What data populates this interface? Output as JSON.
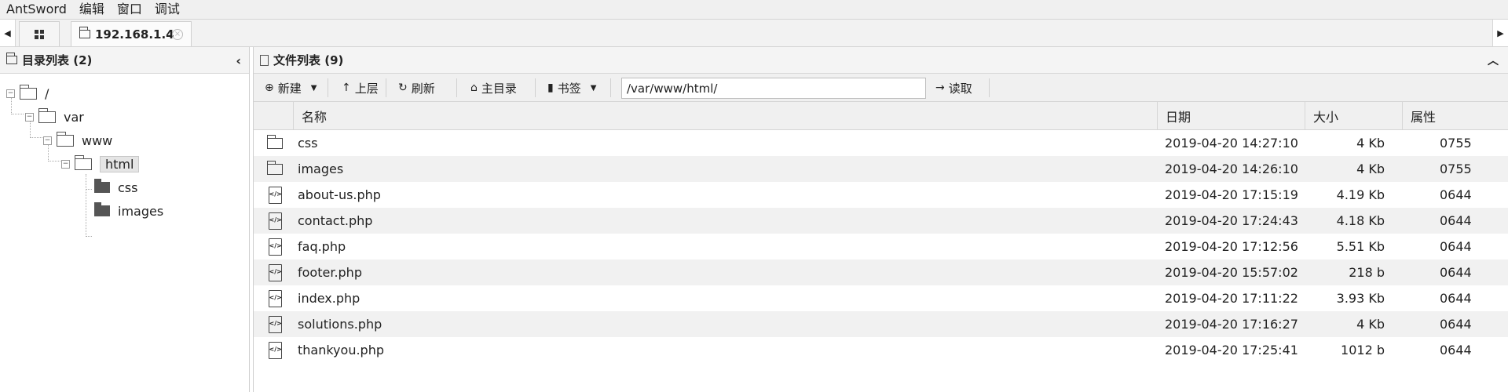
{
  "menu": [
    "AntSword",
    "编辑",
    "窗口",
    "调试"
  ],
  "tabs": {
    "host_label": "192.168.1.4",
    "left_arrow": "◀",
    "right_arrow": "▶",
    "close_symbol": "×"
  },
  "dir_panel": {
    "title": "目录列表 (2)",
    "collapse_symbol": "‹",
    "tree": [
      {
        "label": "/",
        "expander": "−"
      },
      {
        "label": "var",
        "expander": "−"
      },
      {
        "label": "www",
        "expander": "−"
      },
      {
        "label": "html",
        "expander": "−",
        "selected": true
      },
      {
        "label": "css"
      },
      {
        "label": "images"
      }
    ]
  },
  "file_panel": {
    "title": "文件列表 (9)",
    "collapse_symbol": "︿",
    "toolbar": {
      "new_label": "新建",
      "up_label": "上层",
      "refresh_label": "刷新",
      "home_label": "主目录",
      "bookmark_label": "书签",
      "path_value": "/var/www/html/",
      "read_label": "读取"
    },
    "columns": {
      "name": "名称",
      "date": "日期",
      "size": "大小",
      "attr": "属性"
    },
    "files": [
      {
        "type": "folder",
        "name": "css",
        "date": "2019-04-20 14:27:10",
        "size": "4 Kb",
        "attr": "0755"
      },
      {
        "type": "folder",
        "name": "images",
        "date": "2019-04-20 14:26:10",
        "size": "4 Kb",
        "attr": "0755"
      },
      {
        "type": "file",
        "name": "about-us.php",
        "date": "2019-04-20 17:15:19",
        "size": "4.19 Kb",
        "attr": "0644"
      },
      {
        "type": "file",
        "name": "contact.php",
        "date": "2019-04-20 17:24:43",
        "size": "4.18 Kb",
        "attr": "0644"
      },
      {
        "type": "file",
        "name": "faq.php",
        "date": "2019-04-20 17:12:56",
        "size": "5.51 Kb",
        "attr": "0644"
      },
      {
        "type": "file",
        "name": "footer.php",
        "date": "2019-04-20 15:57:02",
        "size": "218 b",
        "attr": "0644"
      },
      {
        "type": "file",
        "name": "index.php",
        "date": "2019-04-20 17:11:22",
        "size": "3.93 Kb",
        "attr": "0644"
      },
      {
        "type": "file",
        "name": "solutions.php",
        "date": "2019-04-20 17:16:27",
        "size": "4 Kb",
        "attr": "0644"
      },
      {
        "type": "file",
        "name": "thankyou.php",
        "date": "2019-04-20 17:25:41",
        "size": "1012 b",
        "attr": "0644"
      }
    ]
  }
}
